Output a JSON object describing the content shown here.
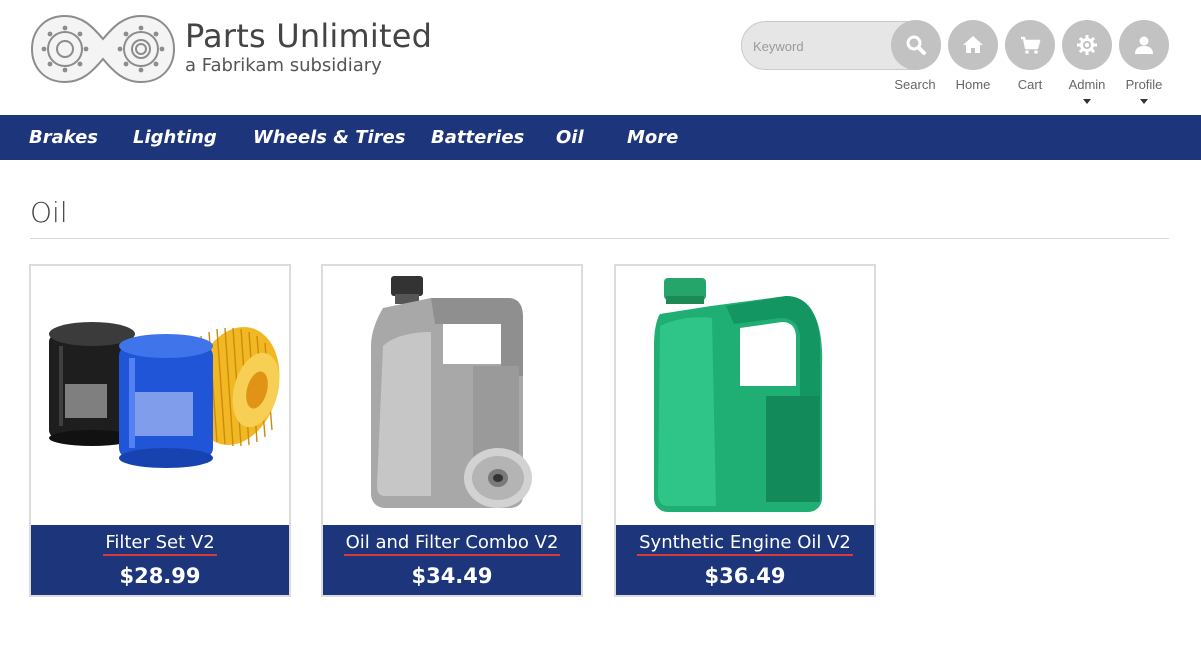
{
  "brand": {
    "title": "Parts Unlimited",
    "subtitle": "a Fabrikam subsidiary"
  },
  "search": {
    "placeholder": "Keyword",
    "label": "Search"
  },
  "header_nav": [
    {
      "label": "Home",
      "icon": "home-icon"
    },
    {
      "label": "Cart",
      "icon": "cart-icon"
    },
    {
      "label": "Admin",
      "icon": "gear-icon"
    },
    {
      "label": "Profile",
      "icon": "user-icon"
    }
  ],
  "categories": [
    "Brakes",
    "Lighting",
    "Wheels & Tires",
    "Batteries",
    "Oil",
    "More"
  ],
  "page_title": "Oil",
  "products": [
    {
      "name": "Filter Set V2",
      "price": "$28.99",
      "image": "oil-filter-set-image"
    },
    {
      "name": "Oil and Filter Combo V2",
      "price": "$34.49",
      "image": "oil-jug-with-filter-image"
    },
    {
      "name": "Synthetic Engine Oil V2",
      "price": "$36.49",
      "image": "green-oil-jug-image"
    }
  ],
  "colors": {
    "nav_blue": "#1c357b",
    "icon_gray": "#c2c2c2",
    "underline_red": "#d63a3a"
  }
}
